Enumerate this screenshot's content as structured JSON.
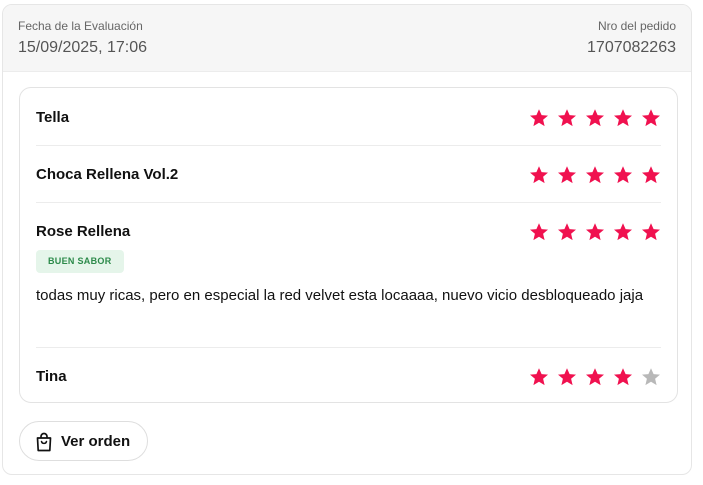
{
  "header": {
    "date_label": "Fecha de la Evaluación",
    "date_value": "15/09/2025, 17:06",
    "order_label": "Nro del pedido",
    "order_value": "1707082263"
  },
  "colors": {
    "star_filled": "#f0114f",
    "star_empty": "#b8b8b8",
    "badge_bg": "#e5f5ea",
    "badge_text": "#2c8a4a"
  },
  "items": [
    {
      "name": "Tella",
      "rating": 5,
      "max": 5
    },
    {
      "name": "Choca Rellena Vol.2",
      "rating": 5,
      "max": 5
    },
    {
      "name": "Rose Rellena",
      "rating": 5,
      "max": 5,
      "tag": "BUEN SABOR",
      "comment": "todas muy ricas, pero en especial la red velvet esta locaaaa, nuevo vicio desbloqueado jaja"
    },
    {
      "name": "Tina",
      "rating": 4,
      "max": 5
    }
  ],
  "actions": {
    "view_order_label": "Ver orden",
    "view_order_icon": "shopping-bag-icon"
  }
}
